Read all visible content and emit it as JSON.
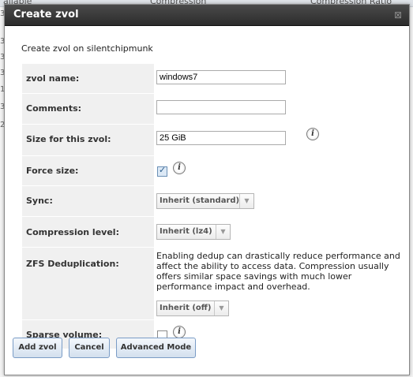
{
  "background": {
    "columns": [
      "ailable",
      "Compression",
      "Compression Ratio"
    ],
    "edge_digits": [
      "3",
      "3",
      "3",
      "3",
      "1",
      "3",
      "2"
    ]
  },
  "dialog": {
    "title": "Create zvol",
    "close": "⊠",
    "subtitle": "Create zvol on silentchipmunk"
  },
  "fields": {
    "name": {
      "label": "zvol name:",
      "value": "windows7"
    },
    "comments": {
      "label": "Comments:",
      "value": ""
    },
    "size": {
      "label": "Size for this zvol:",
      "value": "25 GiB"
    },
    "force": {
      "label": "Force size:",
      "checked": true
    },
    "sync": {
      "label": "Sync:",
      "selected": "Inherit (standard)"
    },
    "compression": {
      "label": "Compression level:",
      "selected": "Inherit (lz4)"
    },
    "dedup": {
      "label": "ZFS Deduplication:",
      "note": "Enabling dedup can drastically reduce performance and affect the ability to access data. Compression usually offers similar space savings with much lower performance impact and overhead.",
      "selected": "Inherit (off)"
    },
    "sparse": {
      "label": "Sparse volume:",
      "checked": false
    }
  },
  "info_glyph": "i",
  "buttons": {
    "add": "Add zvol",
    "cancel": "Cancel",
    "advanced": "Advanced Mode"
  }
}
